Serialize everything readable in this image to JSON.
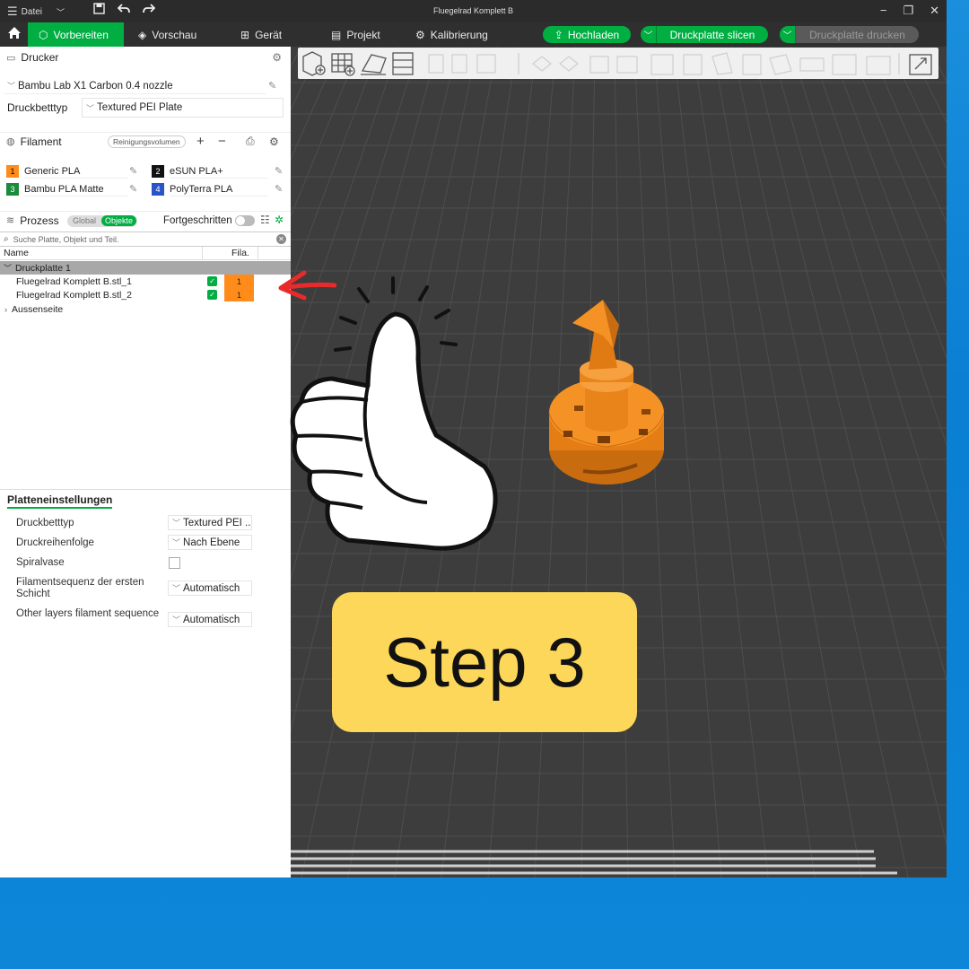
{
  "titlebar": {
    "file_menu": "Datei",
    "window_title": "Fluegelrad Komplett B"
  },
  "menubar": {
    "tabs": [
      {
        "label": "Vorbereiten",
        "icon": "cube-icon"
      },
      {
        "label": "Vorschau",
        "icon": "layers-icon"
      },
      {
        "label": "Gerät",
        "icon": "device-icon"
      },
      {
        "label": "Projekt",
        "icon": "project-icon"
      },
      {
        "label": "Kalibrierung",
        "icon": "calibration-icon"
      }
    ],
    "upload_label": "Hochladen",
    "slice_label": "Druckplatte slicen",
    "print_label": "Druckplatte drucken"
  },
  "printer": {
    "header": "Drucker",
    "printer_name": "Bambu Lab X1 Carbon 0.4 nozzle",
    "bed_type_label": "Druckbetttyp",
    "bed_type_value": "Textured PEI Plate"
  },
  "filament": {
    "header": "Filament",
    "flush_button": "Reinigungsvolumen",
    "items": [
      {
        "num": "1",
        "name": "Generic PLA",
        "color": "#ff8c1a"
      },
      {
        "num": "2",
        "name": "eSUN PLA+",
        "color": "#111111"
      },
      {
        "num": "3",
        "name": "Bambu PLA Matte",
        "color": "#1a8a3c"
      },
      {
        "num": "4",
        "name": "PolyTerra PLA",
        "color": "#2a55c8"
      }
    ]
  },
  "process": {
    "header": "Prozess",
    "global_label": "Global",
    "objects_label": "Objekte",
    "advanced_label": "Fortgeschritten",
    "search_placeholder": "Suche Platte, Objekt und Teil.",
    "col_name": "Name",
    "col_fila": "Fila.",
    "plate_label": "Druckplatte 1",
    "objects": [
      {
        "name": "Fluegelrad Komplett B.stl_1",
        "fila": "1"
      },
      {
        "name": "Fluegelrad Komplett B.stl_2",
        "fila": "1"
      }
    ],
    "outer_label": "Aussenseite"
  },
  "plate_settings": {
    "header": "Platteneinstellungen",
    "rows": [
      {
        "label": "Druckbetttyp",
        "value": "Textured PEI ..."
      },
      {
        "label": "Druckreihenfolge",
        "value": "Nach Ebene"
      },
      {
        "label": "Spiralvase",
        "value": ""
      },
      {
        "label": "Filamentsequenz der ersten Schicht",
        "value": "Automatisch"
      },
      {
        "label": "Other layers filament sequence",
        "value": "Automatisch"
      }
    ]
  },
  "overlay": {
    "step_label": "Step 3"
  },
  "colors": {
    "accent": "#00ae42",
    "model": "#f08a1c",
    "badge": "#fcd75a"
  }
}
